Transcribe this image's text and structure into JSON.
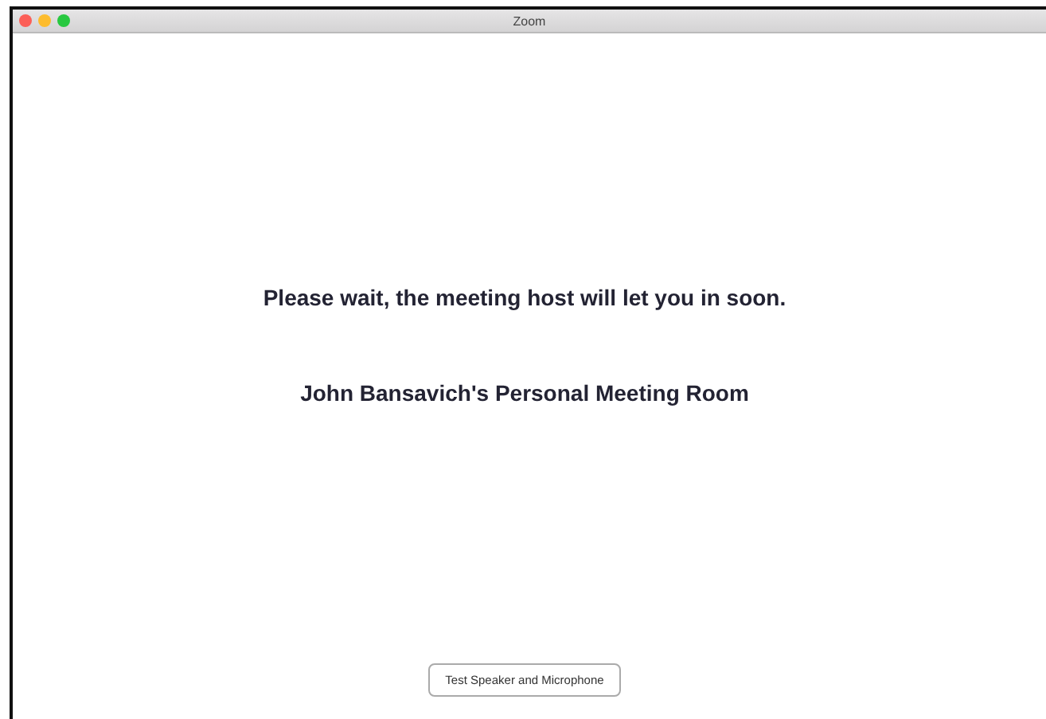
{
  "window": {
    "title": "Zoom"
  },
  "message": "Please wait, the meeting host will let you in soon.",
  "room": "John Bansavich's Personal Meeting Room",
  "button": "Test Speaker and Microphone"
}
